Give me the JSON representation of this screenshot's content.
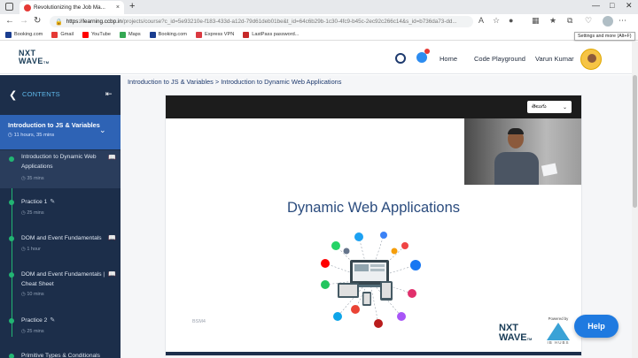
{
  "browser": {
    "tab_title": "Revolutionizing the Job Ma...",
    "tab_close": "×",
    "new_tab": "+",
    "url_host": "https://learning.ccbp.in",
    "url_rest": "/projects/course?c_id=5e93210e-f183-433d-a12d-79d61deb01be&t_id=64c6b29b-1c30-4fc9-b45c-2ec92c266c14&s_id=b736da73-dd...",
    "tooltip": "Settings and more (Alt+F)",
    "bookmarks": [
      {
        "label": "Booking.com",
        "color": "#1a3d8f"
      },
      {
        "label": "Gmail",
        "color": "#e53935"
      },
      {
        "label": "YouTube",
        "color": "#ff0000"
      },
      {
        "label": "Maps",
        "color": "#34a853"
      },
      {
        "label": "Booking.com",
        "color": "#1a3d8f"
      },
      {
        "label": "Express VPN",
        "color": "#da3940"
      },
      {
        "label": "LastPass password...",
        "color": "#c62828"
      }
    ]
  },
  "header": {
    "logo_top": "NXT",
    "logo_bottom": "WAVE",
    "logo_tm": "TM",
    "home": "Home",
    "code_playground": "Code Playground",
    "user_name": "Varun Kumar"
  },
  "sidebar": {
    "contents_label": "CONTENTS",
    "topic_title": "Introduction to JS & Variables",
    "topic_time": "11 hours, 35 mins",
    "items": [
      {
        "label": "Introduction to Dynamic Web Applications",
        "sub": "35 mins"
      },
      {
        "label": "Practice 1",
        "sub": "25 mins"
      },
      {
        "label": "DOM and Event Fundamentals",
        "sub": "1 hour"
      },
      {
        "label": "DOM and Event Fundamentals | Cheat Sheet",
        "sub": "10 mins"
      },
      {
        "label": "Practice 2",
        "sub": "25 mins"
      },
      {
        "label": "Primitive Types & Conditionals",
        "sub": ""
      }
    ]
  },
  "main": {
    "breadcrumb": "Introduction to JS & Variables > Introduction to Dynamic Web Applications",
    "language": "తెలుగు",
    "slide_title": "Dynamic Web Applications",
    "watermark": "BSM4",
    "powered_by": "Powered by",
    "ib_hubs": "IB HUBS",
    "help": "Help"
  },
  "colors": {
    "sidebar_bg": "#1c2e4a",
    "topic_bg": "#2e63b5",
    "accent_green": "#22b573",
    "help_button": "#1f7ae0"
  }
}
